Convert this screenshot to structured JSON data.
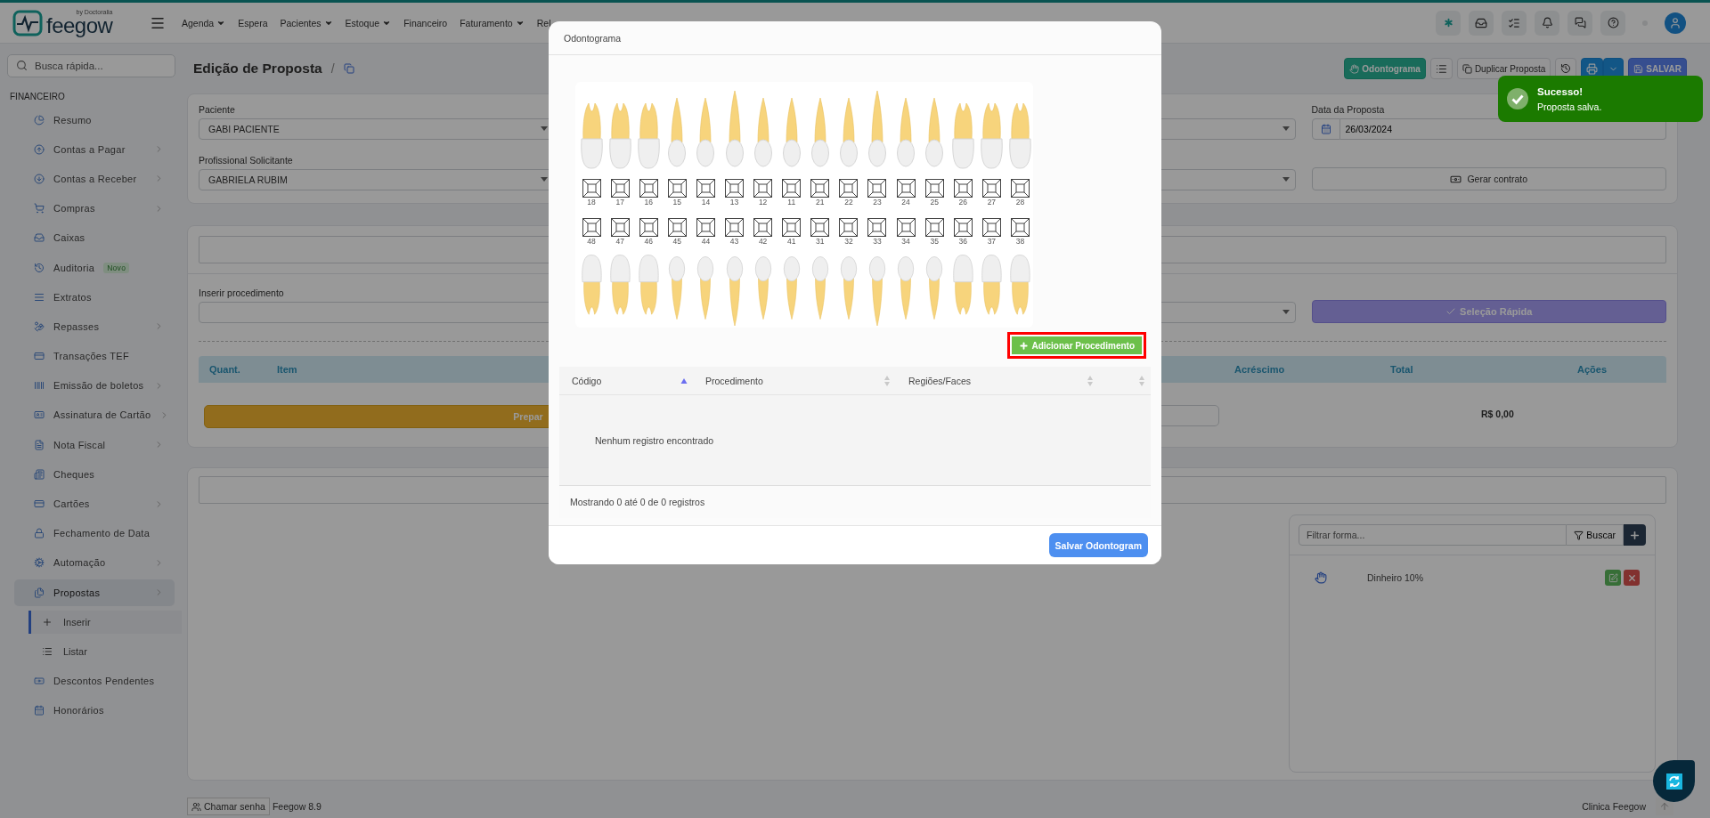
{
  "top_nav": {
    "logo": "feegow",
    "tagline": "by Doctoralia",
    "menu": [
      {
        "label": "Agenda",
        "dropdown": true
      },
      {
        "label": "Espera",
        "dropdown": false
      },
      {
        "label": "Pacientes",
        "dropdown": true
      },
      {
        "label": "Estoque",
        "dropdown": true
      },
      {
        "label": "Financeiro",
        "dropdown": false
      },
      {
        "label": "Faturamento",
        "dropdown": true
      },
      {
        "label": "Rel",
        "dropdown": false
      }
    ]
  },
  "sidebar": {
    "search_placeholder": "Busca rápida...",
    "section": "FINANCEIRO",
    "items": [
      {
        "label": "Resumo",
        "expandable": false,
        "selected": false
      },
      {
        "label": "Contas a Pagar",
        "expandable": true,
        "selected": false
      },
      {
        "label": "Contas a Receber",
        "expandable": true,
        "selected": false
      },
      {
        "label": "Compras",
        "expandable": true,
        "selected": false
      },
      {
        "label": "Caixas",
        "expandable": false,
        "selected": false
      },
      {
        "label": "Auditoria",
        "expandable": false,
        "selected": false,
        "badge": "Novo"
      },
      {
        "label": "Extratos",
        "expandable": false,
        "selected": false
      },
      {
        "label": "Repasses",
        "expandable": true,
        "selected": false
      },
      {
        "label": "Transações TEF",
        "expandable": false,
        "selected": false
      },
      {
        "label": "Emissão de boletos",
        "expandable": true,
        "selected": false
      },
      {
        "label": "Assinatura de Cartão",
        "expandable": true,
        "selected": false
      },
      {
        "label": "Nota Fiscal",
        "expandable": true,
        "selected": false
      },
      {
        "label": "Cheques",
        "expandable": false,
        "selected": false
      },
      {
        "label": "Cartões",
        "expandable": true,
        "selected": false
      },
      {
        "label": "Fechamento de Data",
        "expandable": false,
        "selected": false
      },
      {
        "label": "Automação",
        "expandable": true,
        "selected": false
      },
      {
        "label": "Propostas",
        "expandable": true,
        "selected": true,
        "children": [
          {
            "label": "Inserir",
            "selected": true
          },
          {
            "label": "Listar",
            "selected": false
          }
        ]
      },
      {
        "label": "Descontos Pendentes",
        "expandable": false,
        "selected": false
      },
      {
        "label": "Honorários",
        "expandable": false,
        "selected": false
      }
    ]
  },
  "page": {
    "title": "Edição de Proposta",
    "separator": "/",
    "actions": [
      {
        "kind": "teal",
        "label": "Odontograma"
      },
      {
        "kind": "list"
      },
      {
        "kind": "outline",
        "label": "Duplicar Proposta"
      },
      {
        "kind": "history"
      },
      {
        "kind": "print"
      },
      {
        "kind": "save",
        "label": "SALVAR"
      }
    ]
  },
  "form": {
    "patient": {
      "label": "Paciente",
      "value": "GABI PACIENTE"
    },
    "professional": {
      "label": "Profissional Solicitante",
      "value": "GABRIELA RUBIM"
    },
    "date": {
      "label": "Data da Proposta",
      "value": "26/03/2024"
    },
    "contract_button": "Gerar contrato"
  },
  "items": {
    "procedure_label": "Inserir procedimento",
    "quick_select": "Seleção Rápida",
    "columns": [
      "Quant.",
      "Item",
      "Acréscimo",
      "Total",
      "Ações"
    ],
    "prepare_button": "Prepar",
    "total": "R$ 0,00"
  },
  "payment": {
    "filter_placeholder": "Filtrar forma...",
    "search_button": "Buscar",
    "methods": [
      {
        "label": "Dinheiro 10%"
      }
    ]
  },
  "footer": {
    "call_button": "Chamar senha",
    "version": "Feegow 8.9",
    "clinic": "Clinica Feegow"
  },
  "modal": {
    "title": "Odontograma",
    "upper_teeth": [
      "18",
      "17",
      "16",
      "15",
      "14",
      "13",
      "12",
      "11",
      "21",
      "22",
      "23",
      "24",
      "25",
      "26",
      "27",
      "28"
    ],
    "lower_teeth": [
      "48",
      "47",
      "46",
      "45",
      "44",
      "43",
      "42",
      "41",
      "31",
      "32",
      "33",
      "34",
      "35",
      "36",
      "37",
      "38"
    ],
    "add_button": "Adicionar Procedimento",
    "columns": [
      {
        "label": "Código",
        "sorted": true
      },
      {
        "label": "Procedimento",
        "sorted": false
      },
      {
        "label": "Regiões/Faces",
        "sorted": false
      },
      {
        "sorted": false
      }
    ],
    "empty_message": "Nenhum registro encontrado",
    "info": "Mostrando 0 até 0 de 0 registros",
    "save_button": "Salvar Odontogram"
  },
  "toast": {
    "title": "Sucesso!",
    "message": "Proposta salva."
  }
}
